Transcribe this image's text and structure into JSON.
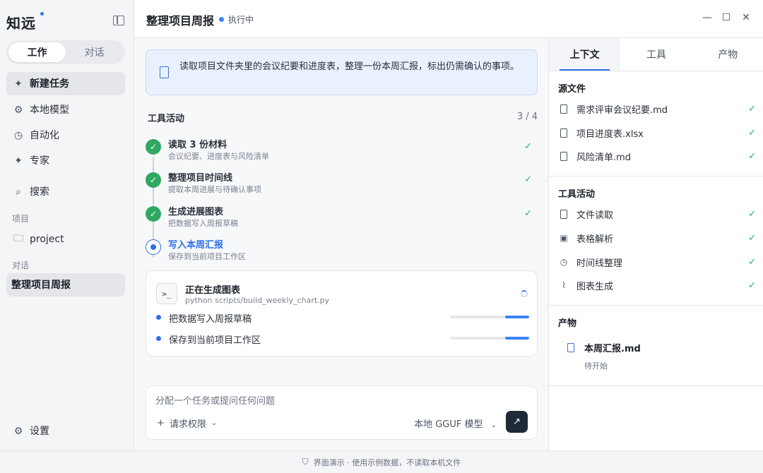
{
  "app": {
    "brand": "知远",
    "modes": [
      "工作",
      "对话"
    ],
    "active_mode": "工作"
  },
  "sidebar": {
    "items": [
      {
        "label": "新建任务",
        "icon": "sparkle-icon"
      },
      {
        "label": "本地模型",
        "icon": "gear-icon"
      },
      {
        "label": "自动化",
        "icon": "clock-icon"
      },
      {
        "label": "专家",
        "icon": "sparkle-icon"
      },
      {
        "label": "搜索",
        "icon": "search-icon"
      }
    ],
    "projects_label": "项目",
    "project": "project",
    "conversations_label": "对话",
    "conversation": "整理项目周报",
    "settings": "设置"
  },
  "header": {
    "title": "整理项目周报",
    "status": "执行中",
    "status_color": "#3b82f6"
  },
  "task": {
    "text": "读取项目文件夹里的会议纪要和进度表，整理一份本周汇报，标出仍需确认的事项。"
  },
  "tool_activity": {
    "heading": "工具活动",
    "count": "3 / 4",
    "steps": [
      {
        "title": "读取 3 份材料",
        "sub": "会议纪要、进度表与风险清单",
        "state": "done"
      },
      {
        "title": "整理项目时间线",
        "sub": "提取本周进展与待确认事项",
        "state": "done"
      },
      {
        "title": "生成进展图表",
        "sub": "把数据写入周报草稿",
        "state": "done"
      },
      {
        "title": "写入本周汇报",
        "sub": "保存到当前项目工作区",
        "state": "current"
      }
    ]
  },
  "running": {
    "title": "正在生成图表",
    "command": "python scripts/build_weekly_chart.py",
    "subtasks": [
      {
        "label": "把数据写入周报草稿",
        "progress": 0.3
      },
      {
        "label": "保存到当前项目工作区",
        "progress": 0.3
      }
    ]
  },
  "composer": {
    "placeholder": "分配一个任务或提问任何问题",
    "permission": "请求权限",
    "model": "本地 GGUF 模型"
  },
  "right_panel": {
    "tabs": [
      "上下文",
      "工具",
      "产物"
    ],
    "active_tab": "上下文",
    "sources_title": "源文件",
    "sources": [
      "需求评审会议纪要.md",
      "项目进度表.xlsx",
      "风险清单.md"
    ],
    "tools_title": "工具活动",
    "tools": [
      {
        "label": "文件读取",
        "icon": "file-icon"
      },
      {
        "label": "表格解析",
        "icon": "terminal-icon"
      },
      {
        "label": "时间线整理",
        "icon": "clock-icon"
      },
      {
        "label": "图表生成",
        "icon": "chart-icon"
      }
    ],
    "artifacts_title": "产物",
    "artifact_name": "本周汇报.md",
    "artifact_status": "待开始"
  },
  "footer": {
    "text": "界面演示 · 使用示例数据，不读取本机文件"
  },
  "colors": {
    "accent": "#2f6fec",
    "success": "#2fa862"
  }
}
